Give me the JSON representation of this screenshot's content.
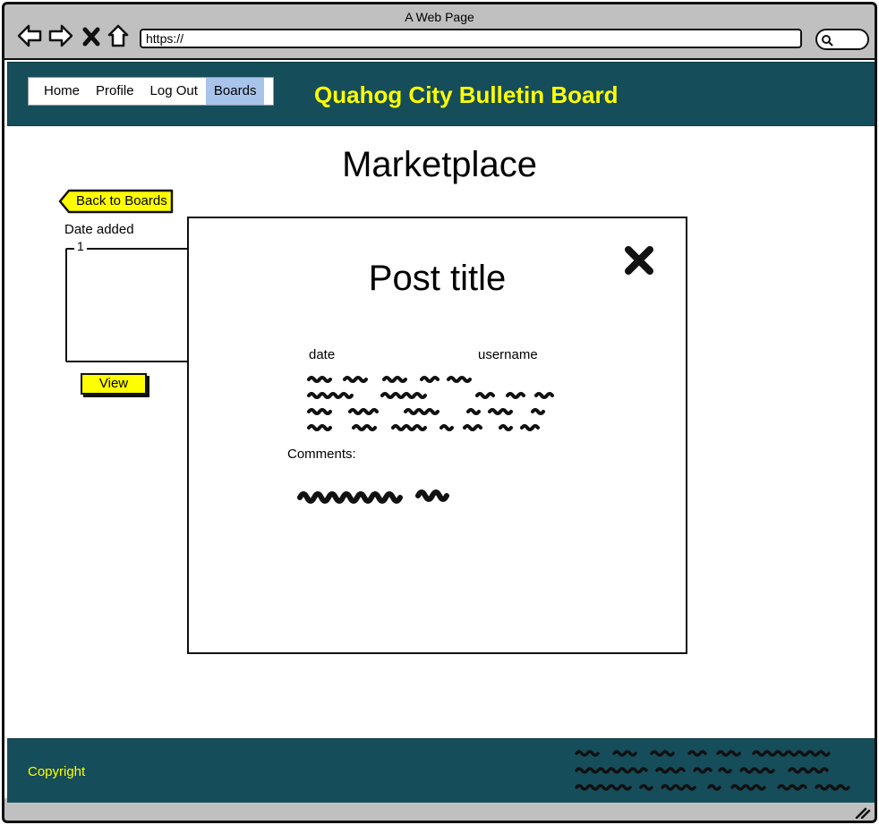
{
  "window": {
    "title": "A Web Page"
  },
  "browser": {
    "url": "https://"
  },
  "header": {
    "tabs": [
      {
        "label": "Home",
        "active": false
      },
      {
        "label": "Profile",
        "active": false
      },
      {
        "label": "Log Out",
        "active": false
      },
      {
        "label": "Boards",
        "active": true
      }
    ],
    "site_title": "Quahog City Bulletin Board"
  },
  "main": {
    "page_title": "Marketplace",
    "back_label": "Back to Boards",
    "date_added_label": "Date added",
    "card_number": "1",
    "view_label": "View"
  },
  "modal": {
    "title": "Post title",
    "date_label": "date",
    "username_label": "username",
    "comments_label": "Comments:"
  },
  "footer": {
    "copyright": "Copyright"
  },
  "colors": {
    "header_bg": "#164d5a",
    "accent_yellow": "#ffff00",
    "active_tab": "#a9c4eb"
  }
}
